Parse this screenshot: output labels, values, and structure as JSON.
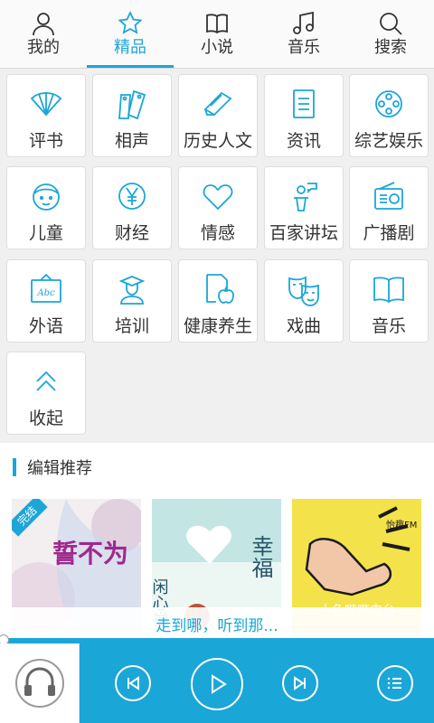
{
  "tabs": [
    {
      "label": "我的",
      "icon": "person-icon"
    },
    {
      "label": "精品",
      "icon": "star-icon",
      "active": true
    },
    {
      "label": "小说",
      "icon": "book-icon"
    },
    {
      "label": "音乐",
      "icon": "music-note-icon"
    },
    {
      "label": "搜索",
      "icon": "search-icon"
    }
  ],
  "categories": [
    {
      "label": "评书",
      "icon": "fan-icon"
    },
    {
      "label": "相声",
      "icon": "tags-icon"
    },
    {
      "label": "历史人文",
      "icon": "closed-book-icon"
    },
    {
      "label": "资讯",
      "icon": "document-icon"
    },
    {
      "label": "综艺娱乐",
      "icon": "film-reel-icon"
    },
    {
      "label": "儿童",
      "icon": "child-face-icon"
    },
    {
      "label": "财经",
      "icon": "yen-coin-icon"
    },
    {
      "label": "情感",
      "icon": "heart-icon"
    },
    {
      "label": "百家讲坛",
      "icon": "podium-speaker-icon"
    },
    {
      "label": "广播剧",
      "icon": "radio-icon"
    },
    {
      "label": "外语",
      "icon": "abc-board-icon"
    },
    {
      "label": "培训",
      "icon": "graduate-icon"
    },
    {
      "label": "健康养生",
      "icon": "apple-doc-icon"
    },
    {
      "label": "戏曲",
      "icon": "opera-masks-icon"
    },
    {
      "label": "音乐",
      "icon": "open-book-icon"
    },
    {
      "label": "收起",
      "icon": "chevron-up-double-icon"
    }
  ],
  "recommend": {
    "title": "编辑推荐",
    "items": [
      {
        "ribbon": "完结",
        "cover_text": "誓不为"
      },
      {
        "cover_text_left": "闲心禅",
        "cover_text_right": "幸福"
      },
      {
        "cover_brand": "怡趣FM",
        "cover_text": "十色哔哔电台"
      }
    ]
  },
  "now_playing": {
    "text": "走到哪，听到那..."
  },
  "colors": {
    "accent": "#1ba6d8",
    "tab_bg": "#fafafa",
    "page_bg": "#f0f0f0"
  }
}
